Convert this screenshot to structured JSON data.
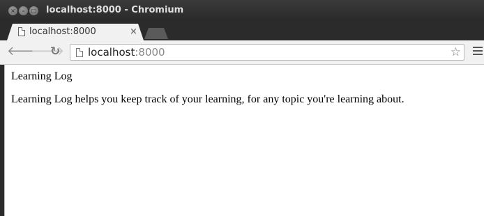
{
  "window": {
    "title": "localhost:8000 - Chromium",
    "controls": [
      "close-icon",
      "minimize-icon",
      "maximize-icon"
    ]
  },
  "tabs": [
    {
      "label": "localhost:8000",
      "close_glyph": "×",
      "active": true
    }
  ],
  "toolbar": {
    "back_icon": "back-arrow-icon",
    "forward_icon": "forward-arrow-icon",
    "reload_icon": "reload-icon",
    "address_host": "localhost",
    "address_port": ":8000",
    "bookmark_icon": "star-icon",
    "menu_icon": "hamburger-menu-icon"
  },
  "page": {
    "heading": "Learning Log",
    "paragraph": "Learning Log helps you keep track of your learning, for any topic you're learning about."
  },
  "colors": {
    "titlebar": "#2b2b2b",
    "toolbar": "#f1f1f1",
    "content_bg": "#ffffff"
  }
}
